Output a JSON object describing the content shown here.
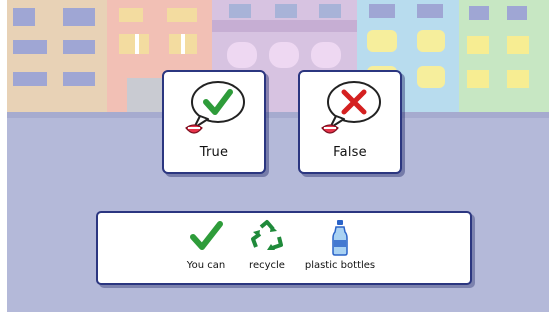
{
  "cards": [
    {
      "label": "True",
      "icon": "true-speech-icon"
    },
    {
      "label": "False",
      "icon": "false-speech-icon"
    }
  ],
  "sentence": {
    "words": [
      {
        "text": "You can",
        "icon": "checkmark-icon"
      },
      {
        "text": "recycle",
        "icon": "recycle-icon"
      },
      {
        "text": "plastic bottles",
        "icon": "plastic-bottle-icon"
      }
    ]
  },
  "colors": {
    "card_border": "#2b3680",
    "check_green": "#2e9c3a",
    "cross_red": "#d42020",
    "ground": "#b4b9d9"
  }
}
